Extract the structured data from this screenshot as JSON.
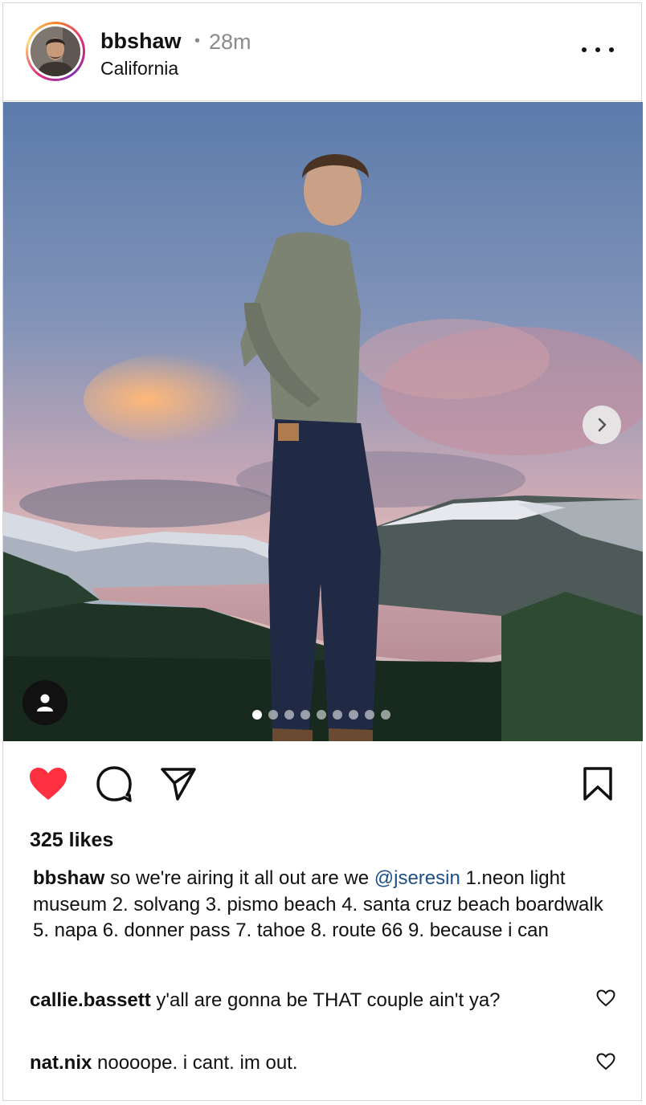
{
  "post": {
    "username": "bbshaw",
    "separator": "•",
    "time_ago": "28m",
    "location": "California",
    "more_icon": "more-horizontal-icon",
    "avatar_icon": "profile-photo"
  },
  "media": {
    "slide_count": 9,
    "active_slide": 1,
    "next_icon": "chevron-right-icon",
    "tag_icon": "user-icon"
  },
  "actions": {
    "liked": true,
    "like_color": "#ff3040",
    "like_icon": "heart-filled-icon",
    "comment_icon": "comment-icon",
    "share_icon": "paper-plane-icon",
    "save_icon": "bookmark-icon"
  },
  "likes_text": "325 likes",
  "caption": {
    "username": "bbshaw",
    "text_before": " so we're airing it all out are we ",
    "mention": "@jseresin",
    "text_after": " 1.neon light museum 2. solvang 3. pismo beach 4. santa cruz beach boardwalk 5. napa 6. donner pass 7. tahoe 8. route 66 9. because i can"
  },
  "comments": [
    {
      "username": "callie.bassett",
      "text": " y'all are gonna be THAT couple ain't ya?"
    },
    {
      "username": "nat.nix",
      "text": " noooope. i cant. im out."
    }
  ],
  "colors": {
    "mention": "#1c4f87",
    "muted": "#8a8a8a"
  }
}
